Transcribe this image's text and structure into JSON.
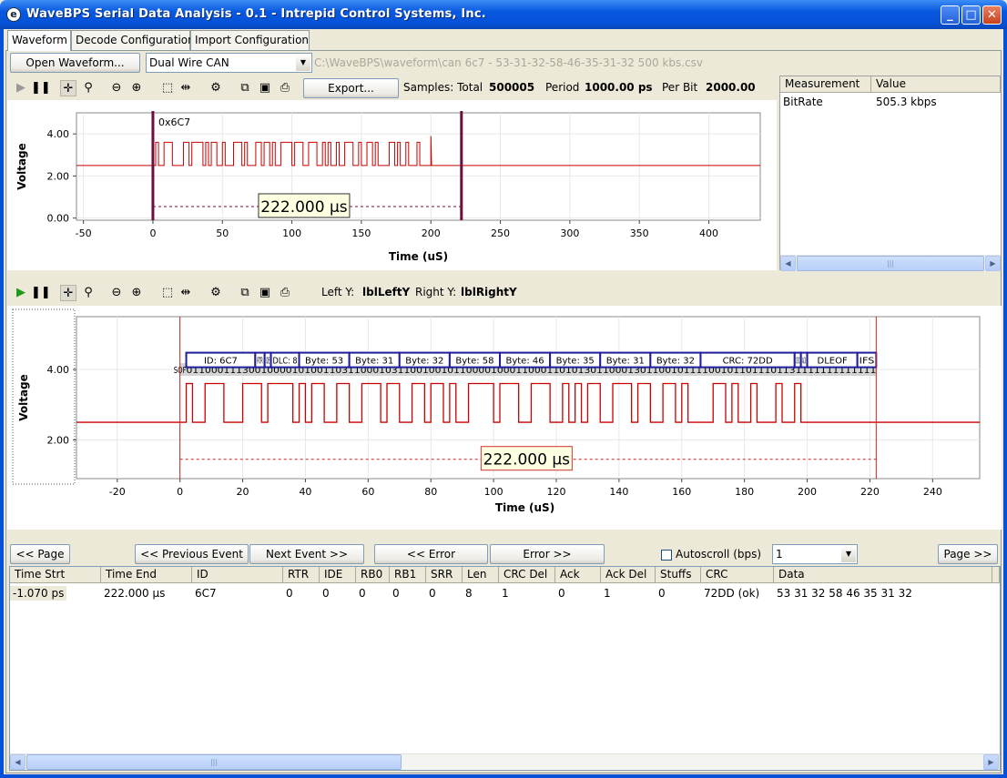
{
  "window": {
    "title": "WaveBPS Serial Data Analysis - 0.1 - Intrepid Control Systems, Inc.",
    "minimize": "_",
    "maximize": "□",
    "close": "✕"
  },
  "tabs": [
    "Waveform",
    "Decode Configuration",
    "Import Configuration"
  ],
  "topbar": {
    "open_label": "Open Waveform...",
    "protocol_selected": "Dual Wire CAN",
    "file_path": "C:\\WaveBPS\\waveform\\can 6c7 - 53-31-32-58-46-35-31-32 500 kbs.csv"
  },
  "toolbar1": {
    "export_label": "Export...",
    "samples_label": "Samples: Total",
    "samples_value": "500005",
    "period_label": "Period",
    "period_value": "1000.00 ps",
    "perbit_label": "Per Bit",
    "perbit_value": "2000.00"
  },
  "toolbar2": {
    "lefty_label": "Left Y:",
    "lefty_value": "lblLeftY",
    "righty_label": "Right Y:",
    "righty_value": "lblRightY"
  },
  "measurements": {
    "headers": [
      "Measurement",
      "Value"
    ],
    "rows": [
      {
        "name": "BitRate",
        "value": "505.3 kbps"
      }
    ]
  },
  "chart_data": [
    {
      "type": "line",
      "name": "overview",
      "ylabel": "Voltage",
      "xlabel": "Time (uS)",
      "xticks": [
        "-50",
        "0",
        "50",
        "100",
        "150",
        "200",
        "250",
        "300",
        "350",
        "400"
      ],
      "yticks": [
        "0.00",
        "2.00",
        "4.00"
      ],
      "xlim": [
        -55,
        437
      ],
      "ylim": [
        -0.1,
        5.0
      ],
      "cursor_label": "0x6C7",
      "cursors_x": [
        0,
        222
      ],
      "span_label": "222.000 µs",
      "idle_level": 2.5,
      "dominant_level": 3.6,
      "recessive_level": 2.5,
      "colors": {
        "signal": "#cc0000",
        "cursor": "#6b0f3b"
      }
    },
    {
      "type": "line",
      "name": "decode",
      "ylabel": "Voltage",
      "xlabel": "Time (uS)",
      "xticks": [
        "-20",
        "0",
        "20",
        "40",
        "60",
        "80",
        "100",
        "120",
        "140",
        "160",
        "180",
        "200",
        "220",
        "240"
      ],
      "yticks": [
        "2.00",
        "4.00"
      ],
      "xlim": [
        -33,
        255
      ],
      "ylim": [
        0.9,
        5.5
      ],
      "cursors_x": [
        0,
        222
      ],
      "span_label": "222.000 µs",
      "idle_level": 2.5,
      "dominant_level": 3.6,
      "sof_label": "SOF",
      "bits": "1011000111300100001010011031100010311001001011000010001100011010130110001301100101111001011011101131111111111111",
      "fields": [
        {
          "label": "ID: 6C7",
          "start": 2,
          "end": 24
        },
        {
          "label": "RTR",
          "start": 24,
          "end": 27
        },
        {
          "label": "IDE",
          "start": 27,
          "end": 29
        },
        {
          "label": "DLC: 8",
          "start": 29,
          "end": 38
        },
        {
          "label": "Byte: 53",
          "start": 38,
          "end": 54
        },
        {
          "label": "Byte: 31",
          "start": 54,
          "end": 70
        },
        {
          "label": "Byte: 32",
          "start": 70,
          "end": 86
        },
        {
          "label": "Byte: 58",
          "start": 86,
          "end": 102
        },
        {
          "label": "Byte: 46",
          "start": 102,
          "end": 118
        },
        {
          "label": "Byte: 35",
          "start": 118,
          "end": 134
        },
        {
          "label": "Byte: 31",
          "start": 134,
          "end": 150
        },
        {
          "label": "Byte: 32",
          "start": 150,
          "end": 166
        },
        {
          "label": "CRC: 72DD",
          "start": 166,
          "end": 196
        },
        {
          "label": "CRC",
          "start": 196,
          "end": 198
        },
        {
          "label": "ACK",
          "start": 198,
          "end": 200
        },
        {
          "label": "DLEOF",
          "start": 200,
          "end": 216
        },
        {
          "label": "IFS",
          "start": 216,
          "end": 222
        }
      ],
      "colors": {
        "signal": "#cc0000",
        "cursor": "#cc2222",
        "field_border": "#1e1e9c"
      }
    }
  ],
  "navbar": {
    "page_prev": "<< Page",
    "prev_event": "<< Previous Event",
    "next_event": "Next Event >>",
    "error_prev": "<< Error",
    "error_next": "Error >>",
    "autoscroll": "Autoscroll (bps)",
    "autoscroll_value": "1",
    "page_next": "Page >>"
  },
  "events": {
    "headers": [
      "Time Strt",
      "Time End",
      "ID",
      "RTR",
      "IDE",
      "RB0",
      "RB1",
      "SRR",
      "Len",
      "CRC Del",
      "Ack",
      "Ack Del",
      "Stuffs",
      "CRC",
      "Data"
    ],
    "rows": [
      [
        "-1.070 ps",
        "222.000 µs",
        "6C7",
        "0",
        "0",
        "0",
        "0",
        "0",
        "8",
        "1",
        "0",
        "1",
        "0",
        "72DD (ok)",
        "53 31 32 58 46 35 31 32"
      ]
    ]
  }
}
